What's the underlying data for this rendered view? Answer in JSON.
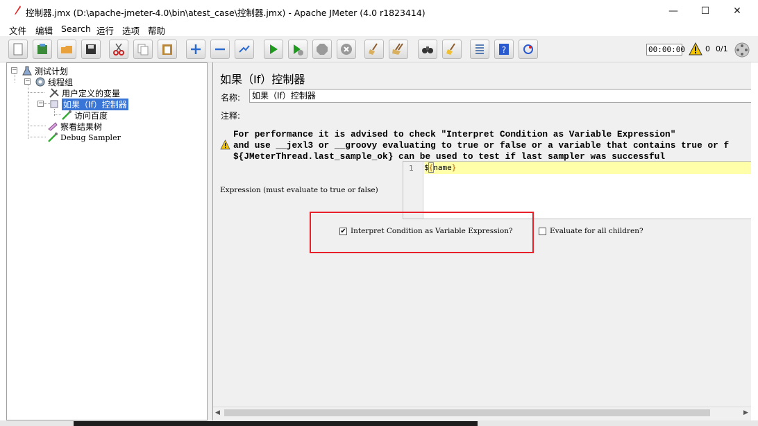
{
  "window": {
    "title": "控制器.jmx (D:\\apache-jmeter-4.0\\bin\\atest_case\\控制器.jmx) - Apache JMeter (4.0 r1823414)",
    "minimize_glyph": "—",
    "maximize_glyph": "☐",
    "close_glyph": "✕"
  },
  "menu": [
    "文件",
    "编辑",
    "Search",
    "运行",
    "选项",
    "帮助"
  ],
  "toolbar": {
    "buttons": [
      "new-icon",
      "templates-icon",
      "open-icon",
      "save-icon",
      "cut-icon",
      "copy-icon",
      "paste-icon",
      "expand-icon",
      "collapse-icon",
      "toggle-icon",
      "start-icon",
      "start-no-pause-icon",
      "stop-icon",
      "shutdown-icon",
      "clear-icon",
      "clear-all-icon",
      "search-icon",
      "reset-search-icon",
      "function-helper-icon",
      "help-icon",
      "remote-icon"
    ],
    "elapsed_time": "00:00:00",
    "error_count": "0",
    "thread_count": "0/1"
  },
  "tree": {
    "test_plan": "测试计划",
    "thread_group": "线程组",
    "user_vars": "用户定义的变量",
    "if_controller": "如果（If）控制器",
    "http_sampler": "访问百度",
    "result_tree": "察看结果树",
    "debug_sampler": "Debug Sampler",
    "expand_glyph": "−"
  },
  "panel": {
    "title": "如果（If）控制器",
    "name_label": "名称:",
    "name_value": "如果（If）控制器",
    "comment_label": "注释:",
    "warning_lines": [
      "For performance it is advised to check \"Interpret Condition as Variable Expression\"",
      "and use __jexl3 or __groovy evaluating to true or false or a variable that contains true or f",
      "${JMeterThread.last_sample_ok} can be used to test if last sampler was successful"
    ],
    "expression_label": "Expression (must evaluate to true or false)",
    "line_number": "1",
    "expr_prefix": "$",
    "expr_open": "{",
    "expr_var": "name",
    "expr_close": "}",
    "interpret_label": "Interpret Condition as Variable Expression?",
    "interpret_checked": "✔",
    "evaluate_all_label": "Evaluate for all children?"
  },
  "colors": {
    "selection": "#3875d7",
    "highlight_box": "#e8202a",
    "current_line": "#ffffaa"
  }
}
